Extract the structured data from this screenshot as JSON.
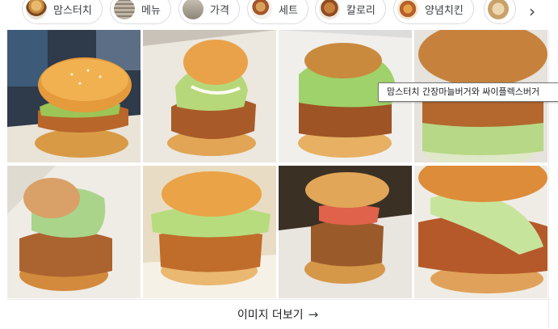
{
  "chips": [
    {
      "label": "맘스터치",
      "icon": "burger-thumb"
    },
    {
      "label": "메뉴",
      "icon": "menu-thumb"
    },
    {
      "label": "가격",
      "icon": "price-thumb"
    },
    {
      "label": "세트",
      "icon": "set-thumb"
    },
    {
      "label": "칼로리",
      "icon": "calorie-thumb"
    },
    {
      "label": "양념치킨",
      "icon": "chicken-thumb"
    },
    {
      "label": "",
      "icon": "next-thumb"
    }
  ],
  "scroll_right_icon": "chevron-right-icon",
  "tooltip": "맘스터치 간장마늘버거와 싸이플렉스버거",
  "more_images": {
    "label": "이미지 더보기",
    "arrow": "→"
  },
  "colors": {
    "border": "#dadce0",
    "text": "#202124"
  }
}
